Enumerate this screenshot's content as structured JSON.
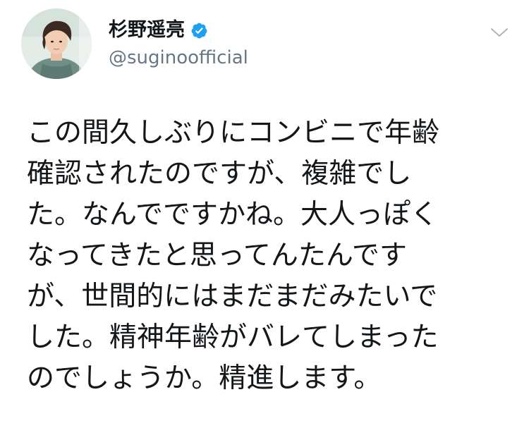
{
  "tweet": {
    "author": {
      "display_name": "杉野遥亮",
      "username": "@suginoofficial",
      "avatar_icon": "profile-photo",
      "verified_icon": "verified-badge-icon",
      "verified_color": "#1da1f2"
    },
    "menu_icon": "chevron-down-icon",
    "text_lines": [
      "この間久しぶりにコンビニで年齢",
      "確認されたのですが、複雑でし",
      "た。なんでですかね。大人っぽく",
      "なってきたと思ってんたんです",
      "が、世間的にはまだまだみたいで",
      "した。精神年齢がバレてしまった",
      "のでしょうか。精進します。"
    ]
  },
  "colors": {
    "text": "#14171a",
    "secondary_text": "#657786",
    "accent": "#1da1f2",
    "chevron": "#aab8c2",
    "background": "#ffffff"
  }
}
